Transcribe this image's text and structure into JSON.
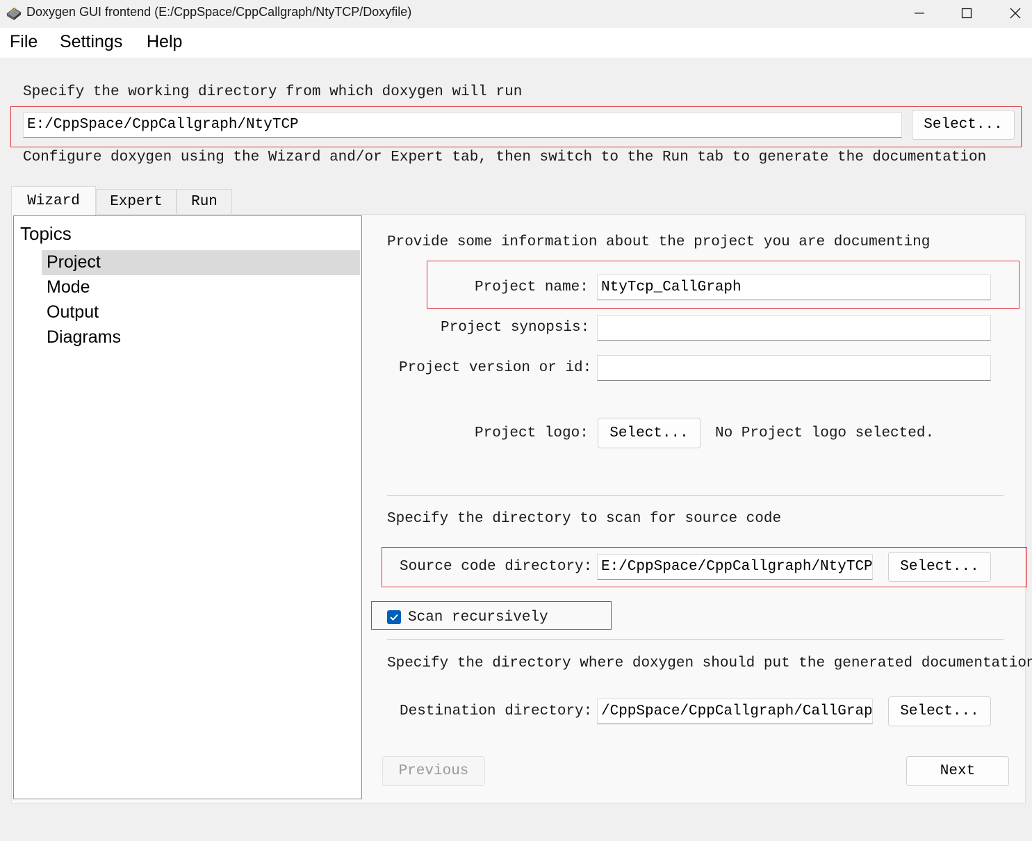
{
  "window": {
    "title": "Doxygen GUI frontend (E:/CppSpace/CppCallgraph/NtyTCP/Doxyfile)",
    "icon": "doxygen-app-icon",
    "controls": [
      "minimize-icon",
      "maximize-icon",
      "close-icon"
    ]
  },
  "menu": {
    "file": "File",
    "settings": "Settings",
    "help": "Help"
  },
  "workdir": {
    "label": "Specify the working directory from which doxygen will run",
    "value": "E:/CppSpace/CppCallgraph/NtyTCP",
    "select": "Select...",
    "hint": "Configure doxygen using the Wizard and/or Expert tab, then switch to the Run tab to generate the documentation"
  },
  "tabs": {
    "wizard": "Wizard",
    "expert": "Expert",
    "run": "Run"
  },
  "topics": {
    "header": "Topics",
    "items": [
      "Project",
      "Mode",
      "Output",
      "Diagrams"
    ],
    "selected": "Project"
  },
  "project": {
    "intro": "Provide some information about the project you are documenting",
    "name_label": "Project name:",
    "name_value": "NtyTcp_CallGraph",
    "synopsis_label": "Project synopsis:",
    "synopsis_value": "",
    "version_label": "Project version or id:",
    "version_value": "",
    "logo_label": "Project logo:",
    "logo_select": "Select...",
    "logo_status": "No Project logo selected."
  },
  "source": {
    "intro": "Specify the directory to scan for source code",
    "dir_label": "Source code directory:",
    "dir_value": "E:/CppSpace/CppCallgraph/NtyTCP",
    "select": "Select...",
    "scan_recursively": "Scan recursively",
    "scan_checked": true
  },
  "destination": {
    "intro": "Specify the directory where doxygen should put the generated documentation",
    "dir_label": "Destination directory:",
    "dir_value": "/CppSpace/CppCallgraph/CallGraph",
    "select": "Select..."
  },
  "nav": {
    "previous": "Previous",
    "next": "Next"
  },
  "colors": {
    "highlight_box": "#e0313b",
    "checkbox_accent": "#005fb8",
    "selected_topic_bg": "#dadada"
  }
}
